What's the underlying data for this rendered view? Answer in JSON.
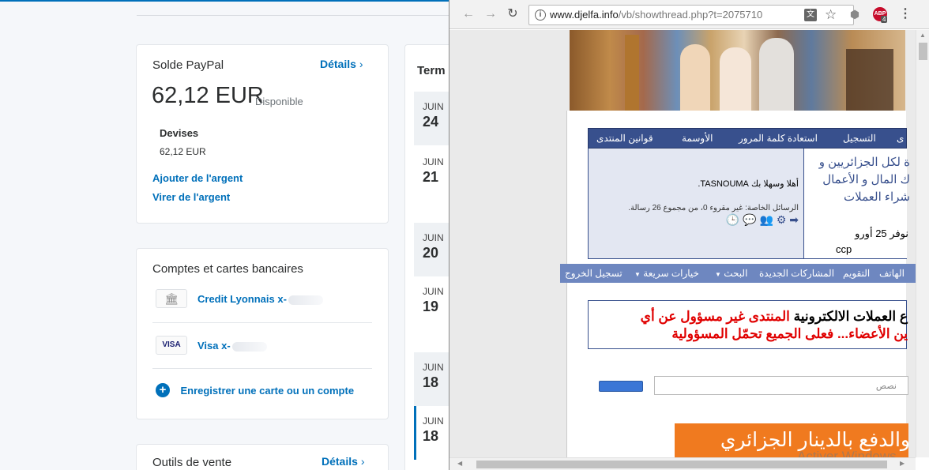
{
  "paypal": {
    "balance_card": {
      "title": "Solde PayPal",
      "details_link": "Détails",
      "amount": "62,12 EUR",
      "available_label": "Disponible",
      "currencies_label": "Devises",
      "currency_line": "62,12 EUR",
      "add_money": "Ajouter de l'argent",
      "transfer_money": "Virer de l'argent"
    },
    "bank_card": {
      "title": "Comptes et cartes bancaires",
      "accounts": [
        {
          "label": "Credit Lyonnais x-",
          "icon": "bank-icon"
        },
        {
          "label": "Visa x-",
          "badge": "VISA"
        }
      ],
      "register_link": "Enregistrer une carte ou un compte"
    },
    "tools_card": {
      "title": "Outils de vente",
      "details_link": "Détails"
    },
    "activity": {
      "title": "Term",
      "dates": [
        {
          "month": "JUIN",
          "day": "24"
        },
        {
          "month": "JUIN",
          "day": "21"
        },
        {
          "month": "JUIN",
          "day": "20"
        },
        {
          "month": "JUIN",
          "day": "19"
        },
        {
          "month": "JUIN",
          "day": "18"
        },
        {
          "month": "JUIN",
          "day": "18"
        }
      ]
    }
  },
  "browser": {
    "url_domain": "www.djelfa.info",
    "url_path": "/vb/showthread.php?t=2075710",
    "back_icon": "back-arrow-icon",
    "forward_icon": "forward-arrow-icon",
    "reload_icon": "reload-icon",
    "abp_badge": "ABP",
    "abp_count": "4"
  },
  "forum": {
    "nav": [
      "قوانين المنتدى",
      "الأوسمة",
      "استعادة كلمة المرور",
      "التسجيل",
      "ى"
    ],
    "welcome": "أهلا وسهلا بك TASNOUMA.",
    "welcome_name": "TASNOUMA",
    "messages": "الرسائل الخاصة: غير مقروء 0، من مجموع 26 رسالة.",
    "ad_lines": [
      "ة لكل الجزائريين و",
      "ك المال و الأعمال",
      "شراء العملات"
    ],
    "offer_line1": "نوفر 25 أورو",
    "offer_line2": "ccp",
    "nav2": [
      "الهاتف",
      "التقويم",
      "المشاركات الجديدة",
      "البحث",
      "خيارات سريعة",
      "تسجيل الخروج"
    ],
    "notice_black": "ع العملات الالكترونية",
    "notice_red1": "المنتدى غير مسؤول عن أي",
    "notice_red2": "ين الأعضاء... فعلى الجميع تحمّل المسؤولية",
    "search_placeholder": "نصص",
    "banner": "والدفع بالدينار الجزائري",
    "watermark": "Activer Windows"
  }
}
